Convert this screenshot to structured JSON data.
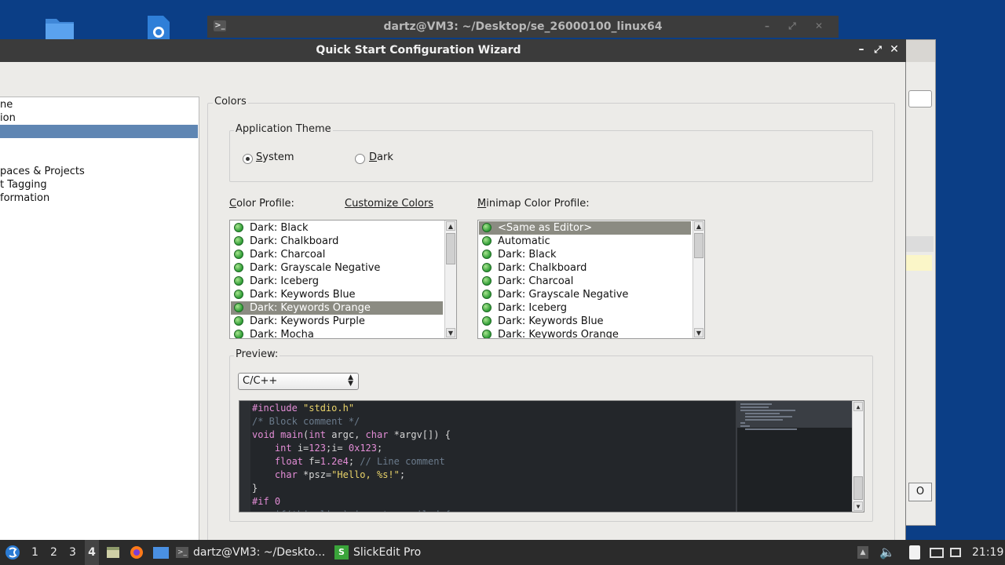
{
  "terminal": {
    "title": "dartz@VM3: ~/Desktop/se_26000100_linux64"
  },
  "background_window": {
    "button_label": "O"
  },
  "dialog": {
    "title": "Quick Start Configuration Wizard",
    "buttons": {
      "minimize": "–",
      "maximize": "⤢",
      "close": "✕"
    }
  },
  "nav": {
    "items": [
      {
        "label": "ne",
        "selected": false
      },
      {
        "label": "ion",
        "selected": false
      },
      {
        "label": "",
        "selected": true
      },
      {
        "label": "",
        "selected": false
      },
      {
        "label": "",
        "selected": false
      },
      {
        "label": "paces & Projects",
        "selected": false
      },
      {
        "label": "t Tagging",
        "selected": false
      },
      {
        "label": "formation",
        "selected": false
      }
    ]
  },
  "colors": {
    "group_label": "Colors",
    "theme": {
      "group_label": "Application Theme",
      "options": [
        {
          "label": "System",
          "selected": true
        },
        {
          "label": "Dark",
          "selected": false
        }
      ]
    },
    "color_profile_label": "Color Profile:",
    "customize_link": "Customize Colors",
    "color_profiles": [
      {
        "label": "Dark: Black",
        "selected": false
      },
      {
        "label": "Dark: Chalkboard",
        "selected": false
      },
      {
        "label": "Dark: Charcoal",
        "selected": false
      },
      {
        "label": "Dark: Grayscale Negative",
        "selected": false
      },
      {
        "label": "Dark: Iceberg",
        "selected": false
      },
      {
        "label": "Dark: Keywords Blue",
        "selected": false
      },
      {
        "label": "Dark: Keywords Orange",
        "selected": true
      },
      {
        "label": "Dark: Keywords Purple",
        "selected": false
      },
      {
        "label": "Dark: Mocha",
        "selected": false
      }
    ],
    "minimap_profile_label": "Minimap Color Profile:",
    "minimap_profiles": [
      {
        "label": "<Same as Editor>",
        "selected": true
      },
      {
        "label": "Automatic",
        "selected": false
      },
      {
        "label": "Dark: Black",
        "selected": false
      },
      {
        "label": "Dark: Chalkboard",
        "selected": false
      },
      {
        "label": "Dark: Charcoal",
        "selected": false
      },
      {
        "label": "Dark: Grayscale Negative",
        "selected": false
      },
      {
        "label": "Dark: Iceberg",
        "selected": false
      },
      {
        "label": "Dark: Keywords Blue",
        "selected": false
      },
      {
        "label": "Dark: Keywords Orange",
        "selected": false
      }
    ],
    "preview": {
      "label": "Preview:",
      "language": "C/C++",
      "code_lines": [
        "#include \"stdio.h\"",
        "/* Block comment */",
        "void main(int argc, char *argv[]) {",
        "    int i=123;i= 0x123;",
        "    float f=1.2e4; // Line comment",
        "    char *psz=\"Hello, %s!\";",
        "}",
        "#if 0",
        "    if(this line) is not compiled {"
      ]
    }
  },
  "taskbar": {
    "workspaces": [
      "1",
      "2",
      "3",
      "4"
    ],
    "active_workspace": "4",
    "tasks": [
      {
        "label": "dartz@VM3: ~/Deskto..."
      },
      {
        "label": "SlickEdit Pro"
      }
    ],
    "clock": "21:19"
  },
  "colors_palette": {
    "desktop": "#0b3e86",
    "titlebar": "#3b3b3b",
    "nav_selection": "#5f86b3",
    "list_selection": "#8b8b82",
    "editor_bg": "#23262a"
  }
}
